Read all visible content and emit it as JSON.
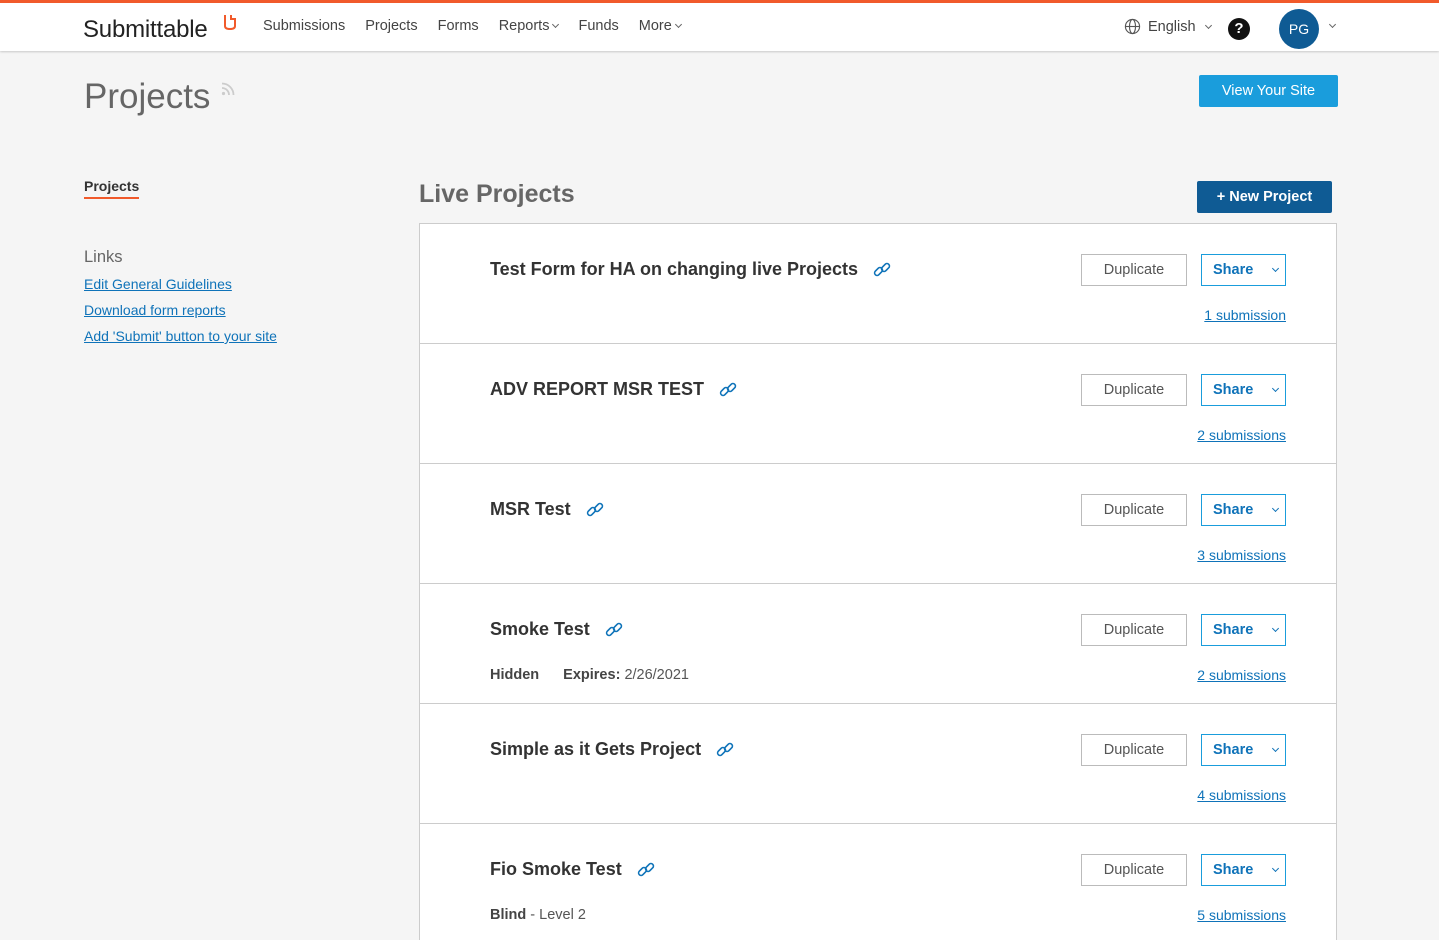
{
  "brand": {
    "name": "Submittable",
    "accent": "#f15a2b"
  },
  "nav": {
    "items": [
      {
        "label": "Submissions",
        "dropdown": false
      },
      {
        "label": "Projects",
        "dropdown": false
      },
      {
        "label": "Forms",
        "dropdown": false
      },
      {
        "label": "Reports",
        "dropdown": true
      },
      {
        "label": "Funds",
        "dropdown": false
      },
      {
        "label": "More",
        "dropdown": true
      }
    ],
    "language": "English",
    "help": "?",
    "user_initials": "PG"
  },
  "page": {
    "title": "Projects",
    "view_site_label": "View Your Site"
  },
  "sidebar": {
    "active_item": "Projects",
    "links_heading": "Links",
    "links": [
      "Edit General Guidelines",
      "Download form reports",
      "Add 'Submit' button to your site"
    ]
  },
  "main": {
    "section_title": "Live Projects",
    "new_project_label": "+ New Project",
    "duplicate_label": "Duplicate",
    "share_label": "Share",
    "projects": [
      {
        "name": "Test Form for HA on changing live Projects",
        "submissions": "1 submission",
        "meta": null
      },
      {
        "name": "ADV REPORT MSR TEST",
        "submissions": "2 submissions",
        "meta": null
      },
      {
        "name": "MSR Test",
        "submissions": "3 submissions",
        "meta": null
      },
      {
        "name": "Smoke Test",
        "submissions": "2 submissions",
        "meta": {
          "status": "Hidden",
          "expires_label": "Expires:",
          "expires_value": "2/26/2021"
        }
      },
      {
        "name": "Simple as it Gets Project",
        "submissions": "4 submissions",
        "meta": null
      },
      {
        "name": "Fio Smoke Test",
        "submissions": "5 submissions",
        "meta": {
          "blind_label": "Blind",
          "blind_value": " - Level 2"
        }
      }
    ]
  },
  "colors": {
    "primary": "#0f5b94",
    "link": "#0f73b9",
    "button_light": "#1a9ddc"
  }
}
